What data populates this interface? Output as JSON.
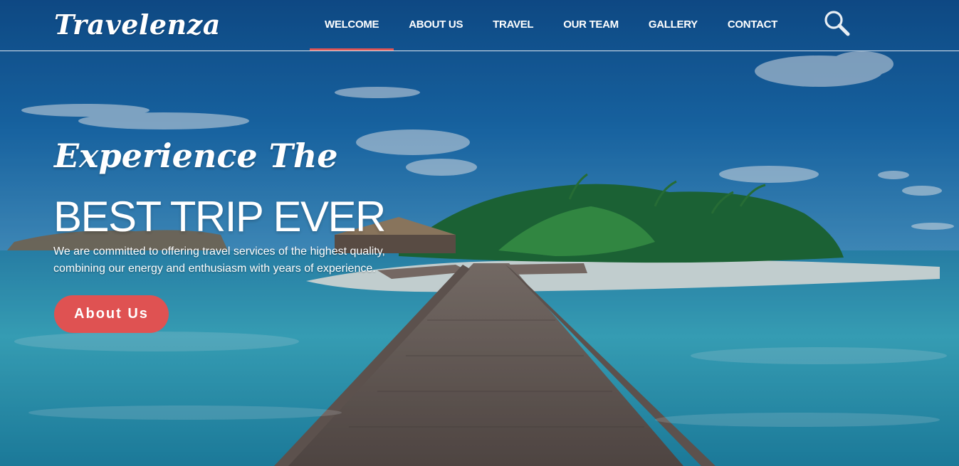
{
  "header": {
    "logo_text": "Travelenza",
    "nav_items": [
      {
        "label": "WELCOME",
        "active": true
      },
      {
        "label": "ABOUT US",
        "active": false
      },
      {
        "label": "TRAVEL",
        "active": false
      },
      {
        "label": "OUR TEAM",
        "active": false
      },
      {
        "label": "GALLERY",
        "active": false
      },
      {
        "label": "CONTACT",
        "active": false
      }
    ],
    "search_icon": "search-icon"
  },
  "hero": {
    "eyebrow": "Experience The",
    "headline": "BEST TRIP EVER",
    "tagline_line1": "We are committed to offering travel services of the highest quality,",
    "tagline_line2": "combining our energy and enthusiasm with years of experience.",
    "cta_label": "About Us"
  },
  "colors": {
    "accent": "#df5252",
    "sky": "#1667a8",
    "sea": "#2aa7bf",
    "text": "#ffffff"
  }
}
